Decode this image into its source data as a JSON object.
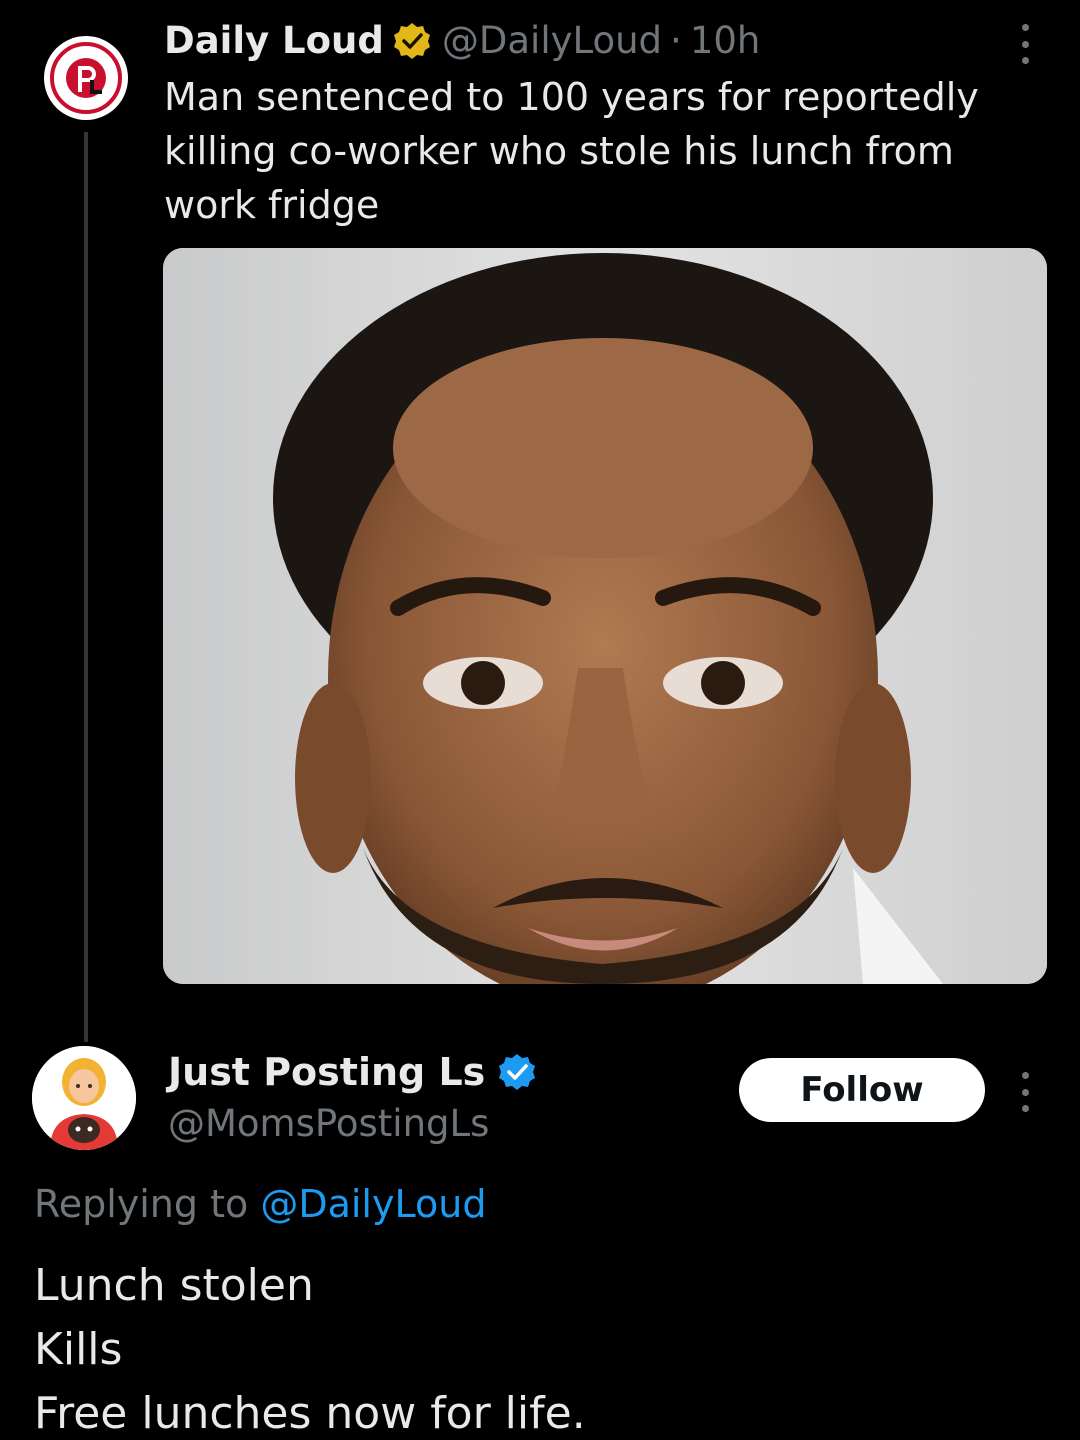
{
  "original_tweet": {
    "display_name": "Daily Loud",
    "handle": "@DailyLoud",
    "separator": "·",
    "time": "10h",
    "verified": "gold",
    "avatar_icon": "daily-loud-logo",
    "text": "Man sentenced to 100 years for reportedly killing co-worker who stole his lunch from work fridge",
    "media_icon": "mugshot-photo"
  },
  "reply": {
    "display_name": "Just Posting Ls",
    "handle": "@MomsPostingLs",
    "verified": "blue",
    "avatar_icon": "woman-with-baby-emoji",
    "follow_label": "Follow",
    "replying_prefix": "Replying to",
    "replying_to": "@DailyLoud",
    "lines": [
      "Lunch stolen",
      "Kills",
      "Free lunches now for life."
    ]
  },
  "colors": {
    "background": "#000000",
    "text": "#e7e9ea",
    "secondary": "#71767b",
    "link": "#1d9bf0",
    "gold_badge": "#e2b719",
    "blue_badge": "#1d9bf0"
  }
}
